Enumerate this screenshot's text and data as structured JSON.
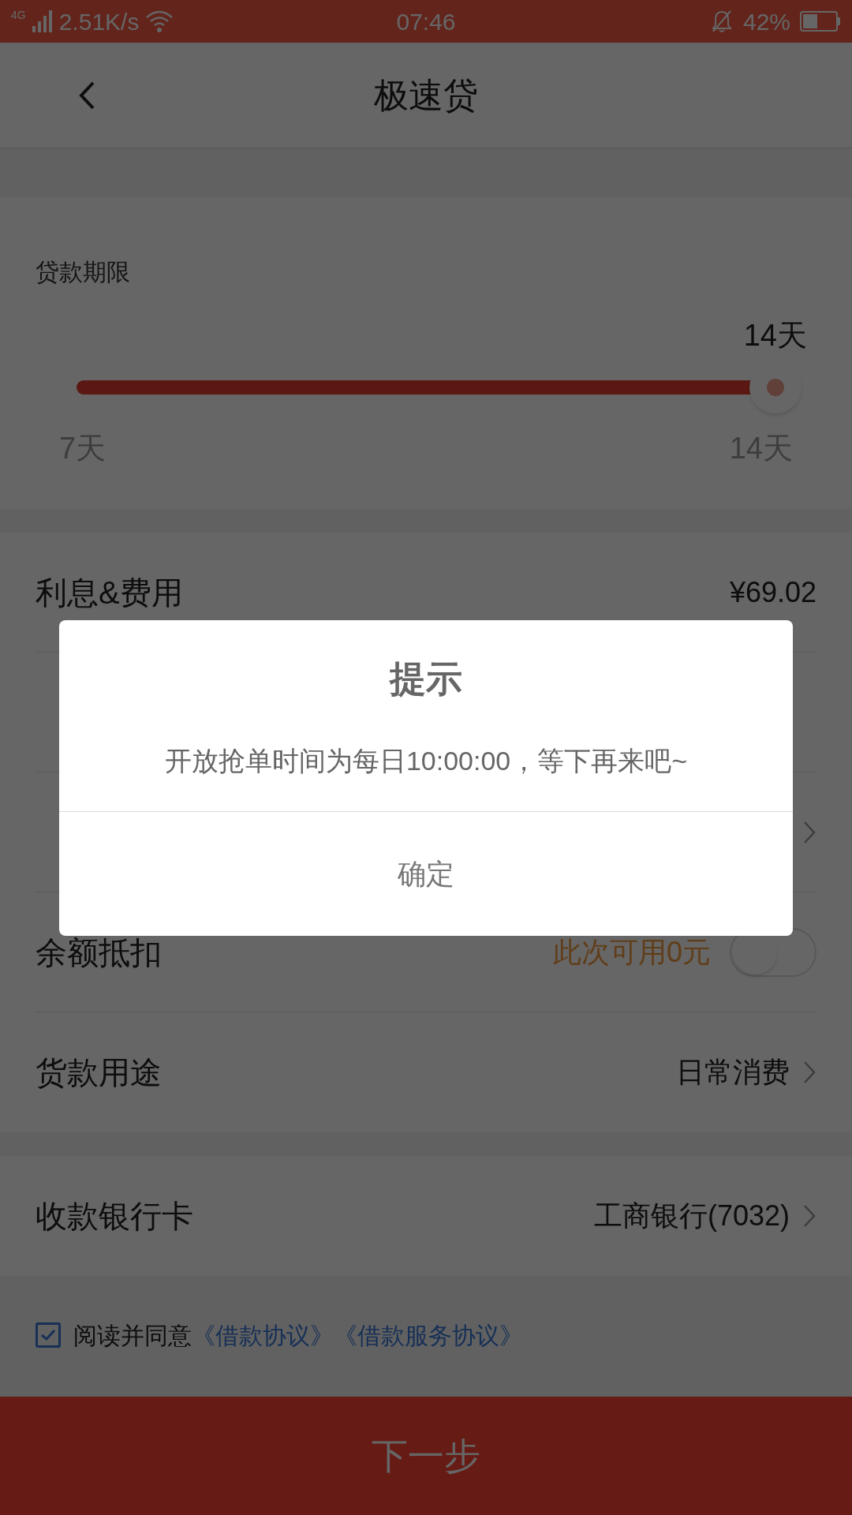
{
  "status_bar": {
    "network": "4G",
    "speed": "2.51K/s",
    "time": "07:46",
    "battery": "42%"
  },
  "nav": {
    "title": "极速贷"
  },
  "term": {
    "label": "贷款期限",
    "value": "14天",
    "level": 1,
    "min_label": "7天",
    "max_label": "14天"
  },
  "rows": [
    {
      "kind": "value",
      "label": "利息&费用",
      "value": "¥69.02"
    },
    {
      "kind": "value"
    },
    {
      "kind": "link"
    },
    {
      "kind": "toggle",
      "label": "余额抵扣",
      "hint": "此次可用0元",
      "on": false
    },
    {
      "kind": "link",
      "label": "货款用途",
      "value": "日常消费"
    }
  ],
  "bank": {
    "label": "收款银行卡",
    "value": "工商银行(7032)"
  },
  "agreement": {
    "checked": true,
    "text": "阅读并同意",
    "links": [
      "《借款协议》",
      "《借款服务协议》"
    ]
  },
  "next_button": "下一步",
  "dialog": {
    "title": "提示",
    "message": "开放抢单时间为每日10:00:00，等下再来吧~",
    "button": "确定"
  }
}
